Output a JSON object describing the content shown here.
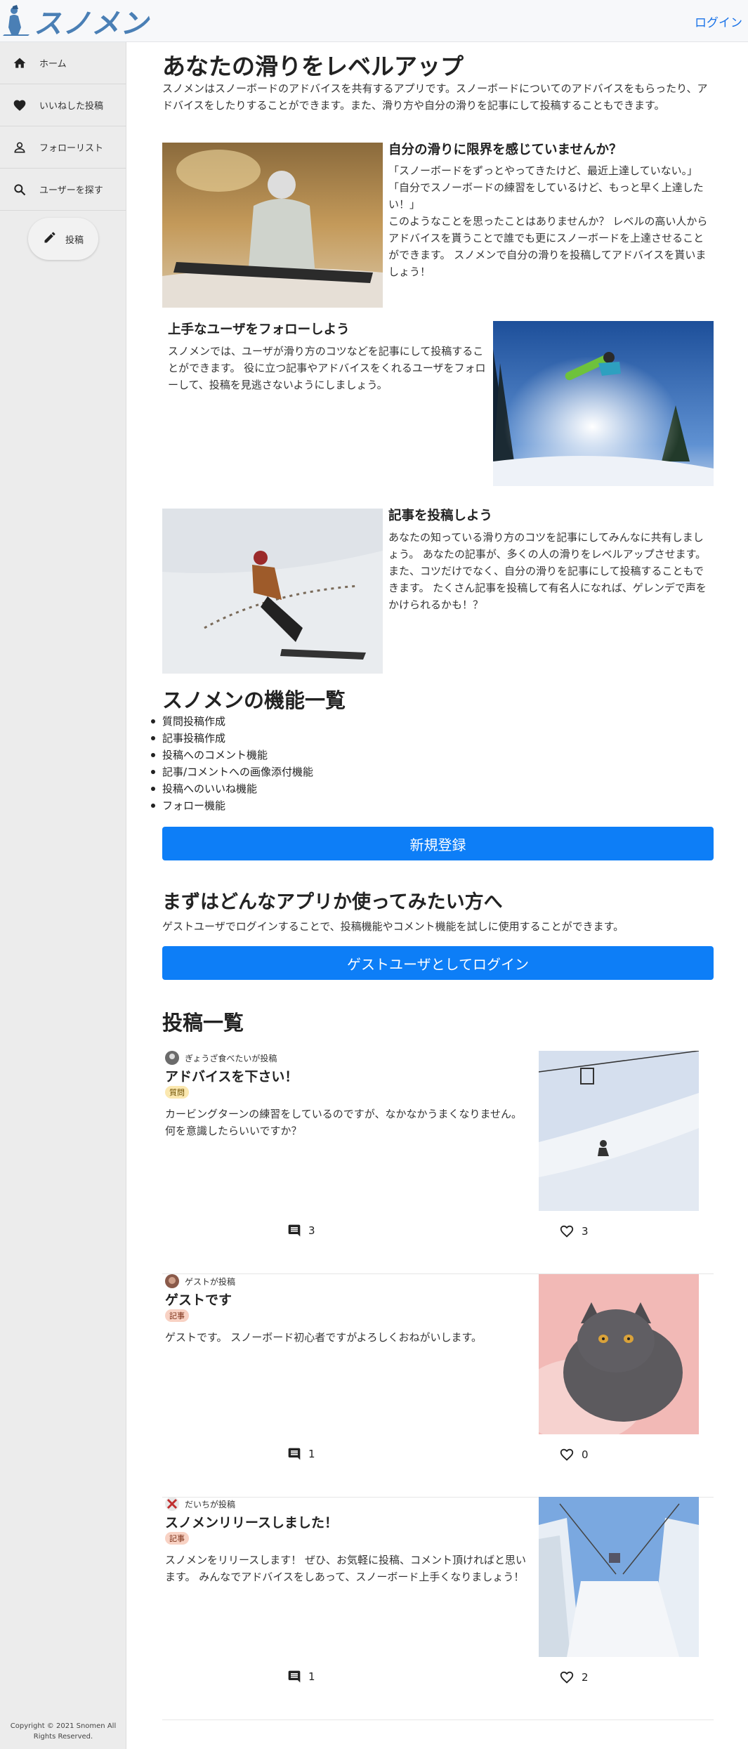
{
  "header": {
    "logo_text": "スノメン",
    "login_label": "ログイン"
  },
  "sidebar": {
    "items": [
      {
        "label": "ホーム",
        "icon": "home-icon"
      },
      {
        "label": "いいねした投稿",
        "icon": "heart-icon"
      },
      {
        "label": "フォローリスト",
        "icon": "person-icon"
      },
      {
        "label": "ユーザーを探す",
        "icon": "search-icon"
      }
    ],
    "post_button_label": "投稿",
    "copyright": "Copyright © 2021 Snomen All Rights Reserved."
  },
  "hero": {
    "title": "あなたの滑りをレベルアップ",
    "description": "スノメンはスノーボードのアドバイスを共有するアプリです。スノーボードについてのアドバイスをもらったり、アドバイスをしたりすることができます。また、滑り方や自分の滑りを記事にして投稿することもできます。"
  },
  "features": [
    {
      "title": "自分の滑りに限界を感じていませんか？",
      "body": "「スノーボードをずっとやってきたけど、最近上達していない。」\n「自分でスノーボードの練習をしているけど、もっと早く上達したい！」\nこのようなことを思ったことはありませんか？ レベルの高い人からアドバイスを貰うことで誰でも更にスノーボードを上達させることができます。 スノメンで自分の滑りを投稿してアドバイスを貰いましょう！"
    },
    {
      "title": "上手なユーザをフォローしよう",
      "body": "スノメンでは、ユーザが滑り方のコツなどを記事にして投稿することができます。 役に立つ記事やアドバイスをくれるユーザをフォローして、投稿を見逃さないようにしましょう。"
    },
    {
      "title": "記事を投稿しよう",
      "body": "あなたの知っている滑り方のコツを記事にしてみんなに共有しましょう。 あなたの記事が、多くの人の滑りをレベルアップさせます。 また、コツだけでなく、自分の滑りを記事にして投稿することもできます。 たくさん記事を投稿して有名人になれば、ゲレンデで声をかけられるかも！？"
    }
  ],
  "functions": {
    "title": "スノメンの機能一覧",
    "items": [
      "質問投稿作成",
      "記事投稿作成",
      "投稿へのコメント機能",
      "記事/コメントへの画像添付機能",
      "投稿へのいいね機能",
      "フォロー機能"
    ],
    "signup_label": "新規登録"
  },
  "guest": {
    "title": "まずはどんなアプリか使ってみたい方へ",
    "description": "ゲストユーザでログインすることで、投稿機能やコメント機能を試しに使用することができます。",
    "button_label": "ゲストユーザとしてログイン"
  },
  "posts": {
    "title": "投稿一覧",
    "items": [
      {
        "poster": "ぎょうざ食べたいが投稿",
        "title": "アドバイスを下さい！",
        "tag": "質問",
        "body": "カービングターンの練習をしているのですが、なかなかうまくなりません。 何を意識したらいいですか？",
        "comments": "3",
        "likes": "3"
      },
      {
        "poster": "ゲストが投稿",
        "title": "ゲストです",
        "tag": "記事",
        "body": "ゲストです。 スノーボード初心者ですがよろしくおねがいします。",
        "comments": "1",
        "likes": "0"
      },
      {
        "poster": "だいちが投稿",
        "title": "スノメンリリースしました！",
        "tag": "記事",
        "body": "スノメンをリリースします！ ぜひ、お気軽に投稿、コメント頂ければと思います。 みんなでアドバイスをしあって、スノーボード上手くなりましょう！",
        "comments": "1",
        "likes": "2"
      }
    ]
  },
  "colors": {
    "accent": "#0d7ef7",
    "logo": "#4a7fb5",
    "sidebar_bg": "#ececec",
    "tag_question": "#fbe8b0",
    "tag_article": "#f8d2c4"
  }
}
